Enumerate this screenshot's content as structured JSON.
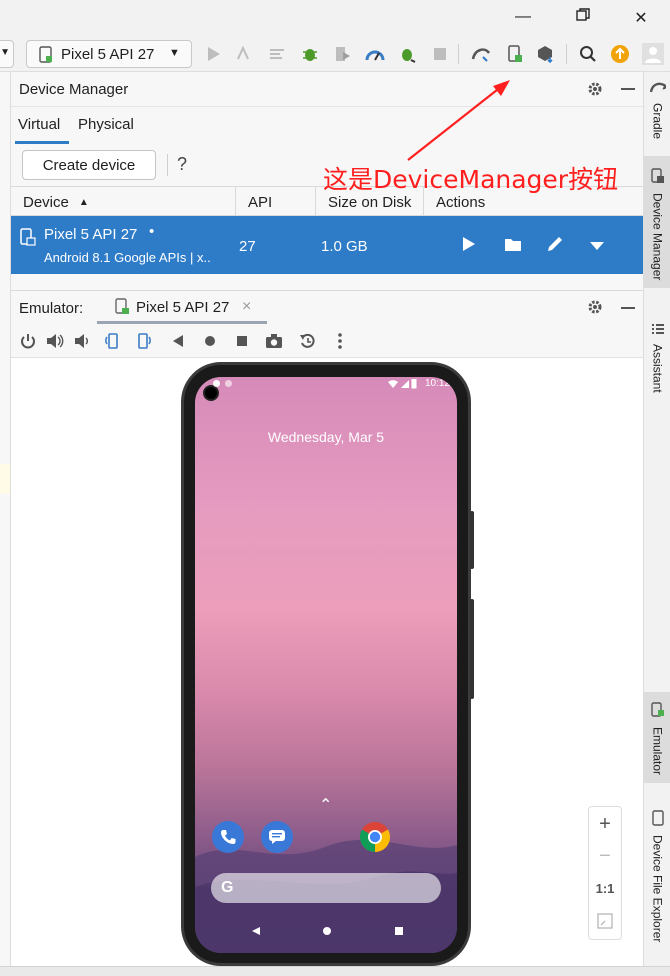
{
  "toolbar": {
    "device_combo_label": "Pixel 5 API 27",
    "icons": [
      "run-icon",
      "apply-changes-icon",
      "sync-icon",
      "debug-icon",
      "profile-icon",
      "profiler-icon",
      "attach-debugger-icon",
      "stop-icon",
      "sdk-manager-icon",
      "device-manager-icon",
      "resource-icon",
      "search-icon",
      "update-icon",
      "avatar-icon"
    ]
  },
  "device_manager": {
    "title": "Device Manager",
    "tabs": [
      "Virtual",
      "Physical"
    ],
    "active_tab": "Virtual",
    "create_button": "Create device",
    "help": "?",
    "columns": [
      "Device",
      "API",
      "Size on Disk",
      "Actions"
    ],
    "rows": [
      {
        "name": "Pixel 5 API 27",
        "status_dot": "•",
        "subtitle": "Android 8.1 Google APIs | x..",
        "api": "27",
        "size": "1.0 GB"
      }
    ]
  },
  "annotation": {
    "text": "这是DeviceManager按钮",
    "color": "#ff1f1f"
  },
  "emulator": {
    "label": "Emulator:",
    "tab_title": "Pixel 5 API 27",
    "tab_close": "×",
    "phone": {
      "time": "10:12",
      "date": "Wednesday, Mar 5",
      "up_arrow": "⌃",
      "search_g": "G"
    },
    "zoom": {
      "plus": "+",
      "minus": "−",
      "ratio": "1:1"
    }
  },
  "right_tabs": [
    "Gradle",
    "Device Manager",
    "Assistant",
    "Emulator",
    "Device File Explorer"
  ],
  "colors": {
    "accent": "#2e7bc8",
    "annotation": "#ff1f1f",
    "run_green": "#4caf50",
    "update_orange": "#f0a30a"
  }
}
